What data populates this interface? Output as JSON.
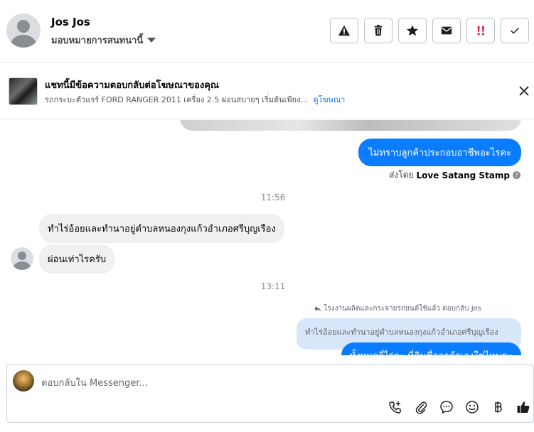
{
  "header": {
    "name": "Jos Jos",
    "assign_label": "มอบหมายการสนทนานี้",
    "actions": [
      "warning-icon",
      "trash-icon",
      "star-icon",
      "mail-icon",
      "double-exclamation-icon",
      "check-icon"
    ],
    "accent_red": "#e41e3f"
  },
  "ad": {
    "title": "แชทนี้มีข้อความตอบกลับต่อโฆษณาของคุณ",
    "subtitle": "รถกระบะตัวแรร์ FORD RANGER 2011 เครื่อง 2.5 ผ่อนสบายๆ เริ่มต้นเพียง...",
    "link": "ดูโฆษณา"
  },
  "chat": {
    "out_message_1": "ไม่ทราบลูกค้าประกอบอาชีพอะไรคะ",
    "sent_by_prefix": "ส่งโดย",
    "sent_by_name": "Love Satang Stamp",
    "time_1": "11:56",
    "in_message_1": "ทำไร่อ้อยและทำนาอยู่ตำบลหนองกุงแก้วอำเภอศรีบุญเรือง",
    "in_message_2": "ผ่อนเท่าไรครับ",
    "time_2": "13:11",
    "reply_meta": "โรงงานผลิตและกระจายรถยนต์ใช้แล้ว ตอบกลับ Jos",
    "reply_quote": "ทำไร่อ้อยและทำนาอยู่ตำบลหนองกุงแก้วอำเภอศรีบุญเรือง",
    "out_message_2": "ทั้งหมดกี่ไร่คะ ที่ดินชื่อลูกค้าเองใช่ไหมคะ",
    "bubble_blue": "#0a7cff"
  },
  "composer": {
    "placeholder": "ตอบกลับใน Messenger...",
    "icons": [
      "phone-plus-icon",
      "paperclip-icon",
      "chat-bubble-icon",
      "smiley-icon",
      "baht-icon",
      "thumbs-up-icon"
    ]
  }
}
